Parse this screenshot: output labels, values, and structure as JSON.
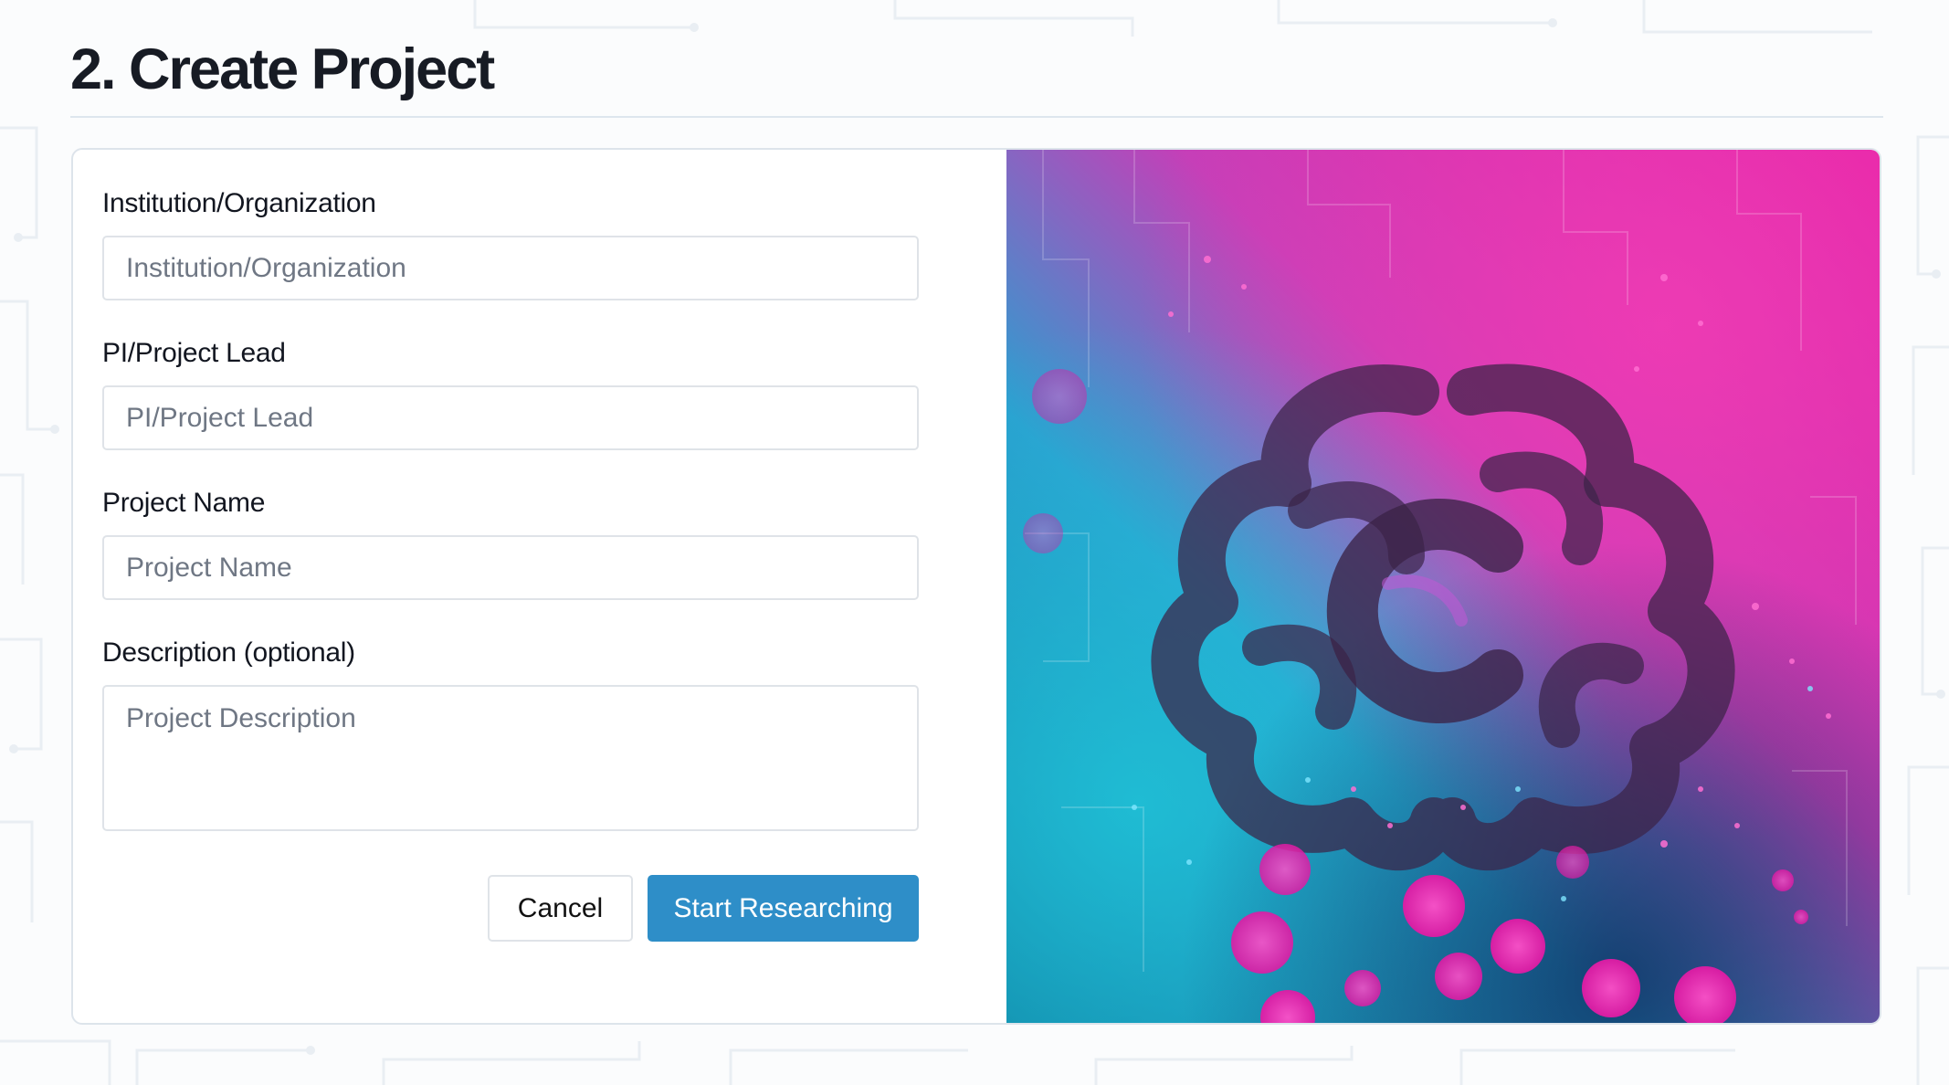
{
  "page": {
    "title": "2. Create Project"
  },
  "form": {
    "fields": [
      {
        "label": "Institution/Organization",
        "placeholder": "Institution/Organization",
        "value": ""
      },
      {
        "label": "PI/Project Lead",
        "placeholder": "PI/Project Lead",
        "value": ""
      },
      {
        "label": "Project Name",
        "placeholder": "Project Name",
        "value": ""
      },
      {
        "label": "Description (optional)",
        "placeholder": "Project Description",
        "value": ""
      }
    ],
    "actions": {
      "cancel_label": "Cancel",
      "submit_label": "Start Researching"
    }
  },
  "illustration": {
    "icon": "brain-icon"
  },
  "colors": {
    "primary_button": "#2e8ec8",
    "title_text": "#171b24",
    "art_magenta": "#e01ca8",
    "art_teal": "#19a9c4"
  }
}
